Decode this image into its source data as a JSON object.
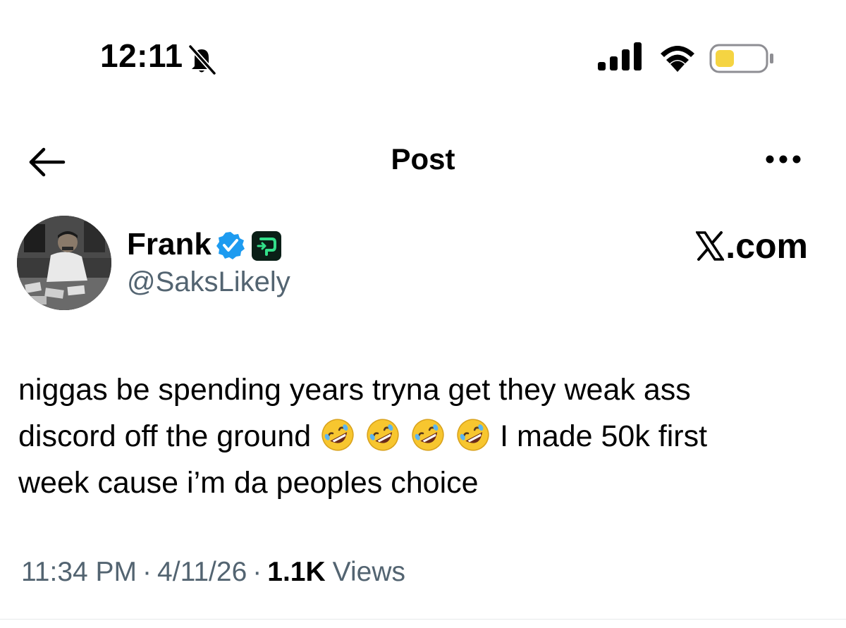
{
  "status_bar": {
    "time": "12:11",
    "icons": [
      "bell-slash-icon",
      "cellular-signal-icon",
      "wifi-icon",
      "battery-icon"
    ],
    "battery_color": "#f5d442"
  },
  "nav": {
    "title": "Post",
    "back_icon": "back-arrow-icon",
    "more_icon": "more-dots-icon"
  },
  "author": {
    "name": "Frank",
    "handle": "@SaksLikely",
    "badges": [
      "verified-icon",
      "affiliate-badge-icon"
    ],
    "verified_color": "#1d9bf0",
    "affiliate_color": "#0a1f17"
  },
  "watermark": {
    "text": ".com"
  },
  "post": {
    "line1": "niggas be spending years tryna get they weak ass",
    "line2_before": "discord off the ground",
    "line2_after": "I made 50k first",
    "line3": "week cause i’m da peoples choice",
    "emojis": [
      "rolling-on-floor-laughing-icon",
      "rolling-on-floor-laughing-icon",
      "rolling-on-floor-laughing-icon",
      "rolling-on-floor-laughing-icon"
    ]
  },
  "meta": {
    "time": "11:34 PM",
    "separator": "·",
    "date": "4/11/26",
    "views_count": "1.1K",
    "views_label": "Views"
  }
}
